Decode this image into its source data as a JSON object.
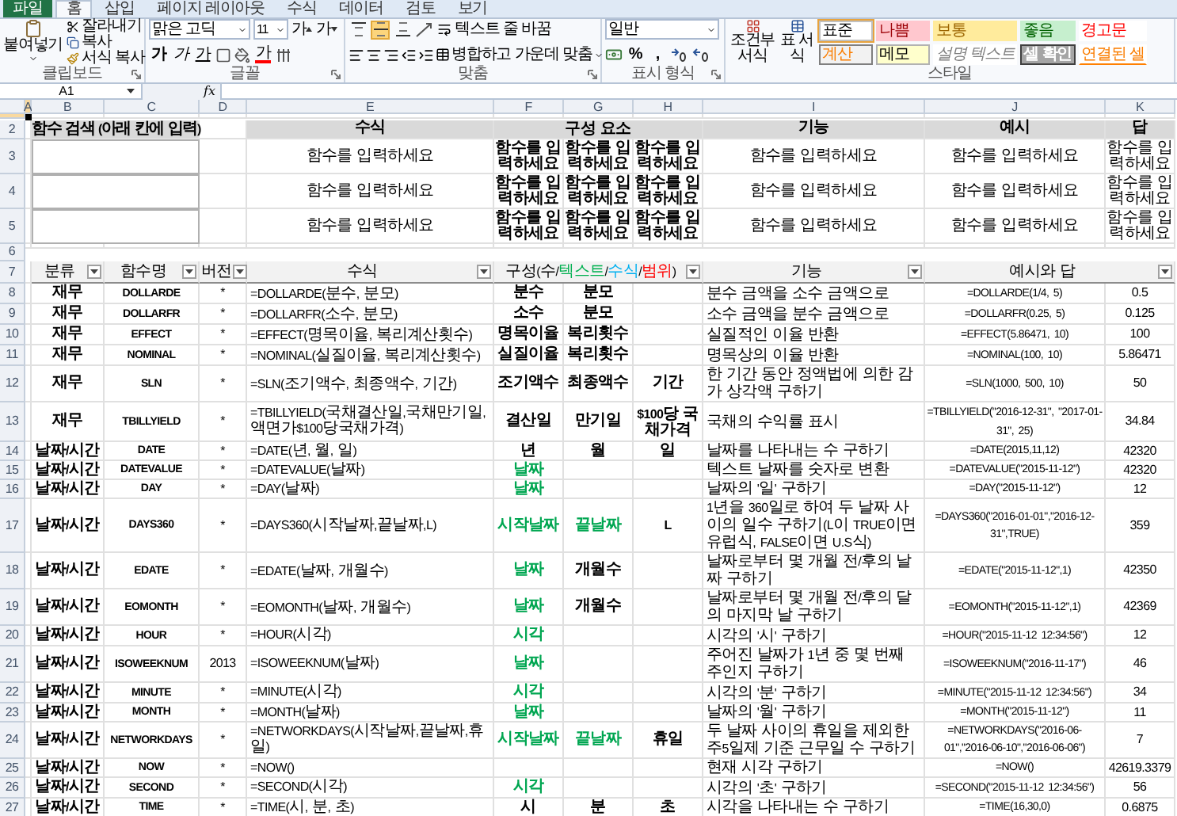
{
  "ribbon": {
    "tabs": [
      {
        "label": "파일",
        "kind": "file",
        "selected": false
      },
      {
        "label": "홈",
        "kind": "tab",
        "selected": true
      },
      {
        "label": "삽입",
        "kind": "tab",
        "selected": false
      },
      {
        "label": "페이지 레이아웃",
        "kind": "tab",
        "selected": false
      },
      {
        "label": "수식",
        "kind": "tab",
        "selected": false
      },
      {
        "label": "데이터",
        "kind": "tab",
        "selected": false
      },
      {
        "label": "검토",
        "kind": "tab",
        "selected": false
      },
      {
        "label": "보기",
        "kind": "tab",
        "selected": false
      }
    ],
    "clipboard": {
      "paste": "붙여넣기",
      "cut": "잘라내기",
      "copy": "복사",
      "format_painter": "서식 복사",
      "label": "클립보드"
    },
    "font": {
      "name": "맑은 고딕",
      "size": "11",
      "grow": "가",
      "shrink": "가",
      "bold": "가",
      "italic": "가",
      "underline": "가",
      "font_color": "가",
      "label": "글꼴"
    },
    "alignment": {
      "vertical": [
        {
          "kind": "top",
          "selected": false
        },
        {
          "kind": "middle",
          "selected": true
        },
        {
          "kind": "bottom",
          "selected": false
        }
      ],
      "wrap": "텍스트 줄 바꿈",
      "merge": "병합하고 가운데 맞춤",
      "label": "맞춤"
    },
    "number": {
      "format": "일반",
      "percent": "%",
      "comma": ",",
      "label": "표시 형식"
    },
    "styles": {
      "conditional": "조건부 서식",
      "table": "표 서식",
      "items": [
        {
          "label": "표준",
          "kind": "normal",
          "selected": true
        },
        {
          "label": "나쁨",
          "kind": "bad",
          "selected": false
        },
        {
          "label": "보통",
          "kind": "neutral",
          "selected": false
        },
        {
          "label": "좋음",
          "kind": "good",
          "selected": false
        },
        {
          "label": "경고문",
          "kind": "warning",
          "selected": false
        },
        {
          "label": "계산",
          "kind": "calculation",
          "selected": false
        },
        {
          "label": "메모",
          "kind": "note",
          "selected": false
        },
        {
          "label": "설명 텍스트",
          "kind": "explanatory",
          "selected": false
        },
        {
          "label": "셀 확인",
          "kind": "check",
          "selected": false
        },
        {
          "label": "연결된 셀",
          "kind": "linked",
          "selected": false
        }
      ],
      "label": "스타일"
    }
  },
  "formula_bar": {
    "name_box": "A1",
    "function_label": "fx"
  },
  "columns": [
    {
      "letter": "A",
      "selected": true
    },
    {
      "letter": "B",
      "selected": false
    },
    {
      "letter": "C",
      "selected": false
    },
    {
      "letter": "D",
      "selected": false
    },
    {
      "letter": "E",
      "selected": false
    },
    {
      "letter": "F",
      "selected": false
    },
    {
      "letter": "G",
      "selected": false
    },
    {
      "letter": "H",
      "selected": false
    },
    {
      "letter": "I",
      "selected": false
    },
    {
      "letter": "J",
      "selected": false
    },
    {
      "letter": "K",
      "selected": false
    }
  ],
  "first_row": {
    "selected": true
  },
  "header_row": {
    "number": "2",
    "search_title": "함수 검색 (아래 칸에 입력)",
    "formula": "수식",
    "components": "구성 요소",
    "function": "기능",
    "example": "예시",
    "answer": "답"
  },
  "preview_rows": [
    {
      "number": "3",
      "formula": "함수를 입력하세요",
      "components": [
        "함수를 입력하세요",
        "함수를 입력하세요",
        "함수를 입력하세요"
      ],
      "function": "함수를 입력하세요",
      "example": "함수를 입력하세요",
      "answer": "함수를 입력하세요"
    },
    {
      "number": "4",
      "formula": "함수를 입력하세요",
      "components": [
        "함수를 입력하세요",
        "함수를 입력하세요",
        "함수를 입력하세요"
      ],
      "function": "함수를 입력하세요",
      "example": "함수를 입력하세요",
      "answer": "함수를 입력하세요"
    },
    {
      "number": "5",
      "formula": "함수를 입력하세요",
      "components": [
        "함수를 입력하세요",
        "함수를 입력하세요",
        "함수를 입력하세요"
      ],
      "function": "함수를 입력하세요",
      "example": "함수를 입력하세요",
      "answer": "함수를 입력하세요"
    }
  ],
  "blank_row": {
    "number": "6"
  },
  "table_header": {
    "number": "7",
    "category": "분류",
    "name": "함수명",
    "version": "버전",
    "formula": "수식",
    "components": [
      {
        "text": "구성("
      },
      {
        "text": "수",
        "color": "#000000"
      },
      {
        "text": "/"
      },
      {
        "text": "텍스트",
        "color": "#00b050"
      },
      {
        "text": "/"
      },
      {
        "text": "수식",
        "color": "#00b0f0"
      },
      {
        "text": "/"
      },
      {
        "text": "범위",
        "color": "#ff0000"
      },
      {
        "text": ")"
      }
    ],
    "function": "기능",
    "example": "예시와 답"
  },
  "rows": [
    {
      "number": "8",
      "category": "재무",
      "name": "DOLLARDE",
      "version": "*",
      "formula": "=DOLLARDE(분수, 분모)",
      "parts": [
        {
          "text": "분수",
          "kind": "number"
        },
        {
          "text": "분모",
          "kind": "number"
        }
      ],
      "function": "분수 금액을 소수 금액으로",
      "example": "=DOLLARDE(1/4, 5)",
      "answer": "0.5"
    },
    {
      "number": "9",
      "category": "재무",
      "name": "DOLLARFR",
      "version": "*",
      "formula": "=DOLLARFR(소수, 분모)",
      "parts": [
        {
          "text": "소수",
          "kind": "number"
        },
        {
          "text": "분모",
          "kind": "number"
        }
      ],
      "function": "소수 금액을 분수 금액으로",
      "example": "=DOLLARFR(0.25, 5)",
      "answer": "0.125"
    },
    {
      "number": "10",
      "category": "재무",
      "name": "EFFECT",
      "version": "*",
      "formula": "=EFFECT(명목이율, 복리계산횟수)",
      "parts": [
        {
          "text": "명목이율",
          "kind": "number"
        },
        {
          "text": "복리횟수",
          "kind": "number"
        }
      ],
      "function": "실질적인 이율 반환",
      "example": "=EFFECT(5.86471, 10)",
      "answer": "100"
    },
    {
      "number": "11",
      "category": "재무",
      "name": "NOMINAL",
      "version": "*",
      "formula": "=NOMINAL(실질이율, 복리계산횟수)",
      "parts": [
        {
          "text": "실질이율",
          "kind": "number"
        },
        {
          "text": "복리횟수",
          "kind": "number"
        }
      ],
      "function": "명목상의 이율 반환",
      "example": "=NOMINAL(100, 10)",
      "answer": "5.86471"
    },
    {
      "number": "12",
      "category": "재무",
      "name": "SLN",
      "version": "*",
      "formula": "=SLN(조기액수, 최종액수, 기간)",
      "parts": [
        {
          "text": "조기액수",
          "kind": "number"
        },
        {
          "text": "최종액수",
          "kind": "number"
        },
        {
          "text": "기간",
          "kind": "number"
        }
      ],
      "function": "한 기간 동안 정액법에 의한 감가 상각액 구하기",
      "example": "=SLN(1000, 500, 10)",
      "answer": "50"
    },
    {
      "number": "13",
      "category": "재무",
      "name": "TBILLYIELD",
      "version": "*",
      "formula": "=TBILLYIELD(국채결산일,국채만기일,액면가$100당국채가격)",
      "parts": [
        {
          "text": "결산일",
          "kind": "number"
        },
        {
          "text": "만기일",
          "kind": "number"
        },
        {
          "text": "$100당 국채가격",
          "kind": "number"
        }
      ],
      "function": "국채의 수익률 표시",
      "example": "=TBILLYIELD(\"2016-12-31\", \"2017-01-31\", 25)",
      "answer": "34.84"
    },
    {
      "number": "14",
      "category": "날짜/시간",
      "name": "DATE",
      "version": "*",
      "formula": "=DATE(년, 월, 일)",
      "parts": [
        {
          "text": "년",
          "kind": "number"
        },
        {
          "text": "월",
          "kind": "number"
        },
        {
          "text": "일",
          "kind": "number"
        }
      ],
      "function": "날짜를 나타내는 수 구하기",
      "example": "=DATE(2015,11,12)",
      "answer": "42320"
    },
    {
      "number": "15",
      "category": "날짜/시간",
      "name": "DATEVALUE",
      "version": "*",
      "formula": "=DATEVALUE(날짜)",
      "parts": [
        {
          "text": "날짜",
          "kind": "text"
        }
      ],
      "function": "텍스트 날짜를 숫자로 변환",
      "example": "=DATEVALUE(\"2015-11-12\")",
      "answer": "42320"
    },
    {
      "number": "16",
      "category": "날짜/시간",
      "name": "DAY",
      "version": "*",
      "formula": "=DAY(날짜)",
      "parts": [
        {
          "text": "날짜",
          "kind": "text"
        }
      ],
      "function": "날짜의 '일' 구하기",
      "example": "=DAY(\"2015-11-12\")",
      "answer": "12"
    },
    {
      "number": "17",
      "category": "날짜/시간",
      "name": "DAYS360",
      "version": "*",
      "formula": "=DAYS360(시작날짜,끝날짜,L)",
      "parts": [
        {
          "text": "시작날짜",
          "kind": "text"
        },
        {
          "text": "끝날짜",
          "kind": "text"
        },
        {
          "text": "L",
          "kind": "number"
        }
      ],
      "function": "1년을 360일로 하여 두 날짜 사이의 일수 구하기(L이 TRUE이면 유럽식, FALSE이면 U.S식)",
      "example": "=DAYS360(\"2016-01-01\",\"2016-12-31\",TRUE)",
      "answer": "359"
    },
    {
      "number": "18",
      "category": "날짜/시간",
      "name": "EDATE",
      "version": "*",
      "formula": "=EDATE(날짜, 개월수)",
      "parts": [
        {
          "text": "날짜",
          "kind": "text"
        },
        {
          "text": "개월수",
          "kind": "number"
        }
      ],
      "function": "날짜로부터 몇 개월 전/후의 날짜 구하기",
      "example": "=EDATE(\"2015-11-12\",1)",
      "answer": "42350"
    },
    {
      "number": "19",
      "category": "날짜/시간",
      "name": "EOMONTH",
      "version": "*",
      "formula": "=EOMONTH(날짜, 개월수)",
      "parts": [
        {
          "text": "날짜",
          "kind": "text"
        },
        {
          "text": "개월수",
          "kind": "number"
        }
      ],
      "function": "날짜로부터 몇 개월 전/후의 달의 마지막 날 구하기",
      "example": "=EOMONTH(\"2015-11-12\",1)",
      "answer": "42369"
    },
    {
      "number": "20",
      "category": "날짜/시간",
      "name": "HOUR",
      "version": "*",
      "formula": "=HOUR(시각)",
      "parts": [
        {
          "text": "시각",
          "kind": "text"
        }
      ],
      "function": "시각의 '시' 구하기",
      "example": "=HOUR(\"2015-11-12 12:34:56\")",
      "answer": "12"
    },
    {
      "number": "21",
      "category": "날짜/시간",
      "name": "ISOWEEKNUM",
      "version": "2013",
      "formula": "=ISOWEEKNUM(날짜)",
      "parts": [
        {
          "text": "날짜",
          "kind": "text"
        }
      ],
      "function": "주어진 날짜가 1년 중 몇 번째 주인지 구하기",
      "example": "=ISOWEEKNUM(\"2016-11-17\")",
      "answer": "46"
    },
    {
      "number": "22",
      "category": "날짜/시간",
      "name": "MINUTE",
      "version": "*",
      "formula": "=MINUTE(시각)",
      "parts": [
        {
          "text": "시각",
          "kind": "text"
        }
      ],
      "function": "시각의 '분' 구하기",
      "example": "=MINUTE(\"2015-11-12 12:34:56\")",
      "answer": "34"
    },
    {
      "number": "23",
      "category": "날짜/시간",
      "name": "MONTH",
      "version": "*",
      "formula": "=MONTH(날짜)",
      "parts": [
        {
          "text": "날짜",
          "kind": "text"
        }
      ],
      "function": "날짜의 '월' 구하기",
      "example": "=MONTH(\"2015-11-12\")",
      "answer": "11"
    },
    {
      "number": "24",
      "category": "날짜/시간",
      "name": "NETWORKDAYS",
      "version": "*",
      "formula": "=NETWORKDAYS(시작날짜,끝날짜,휴일)",
      "parts": [
        {
          "text": "시작날짜",
          "kind": "text"
        },
        {
          "text": "끝날짜",
          "kind": "text"
        },
        {
          "text": "휴일",
          "kind": "number"
        }
      ],
      "function": "두 날짜 사이의 휴일을 제외한 주5일제 기준 근무일 수 구하기",
      "example": "=NETWORKDAYS(\"2016-06-01\",\"2016-06-10\",\"2016-06-06\")",
      "answer": "7"
    },
    {
      "number": "25",
      "category": "날짜/시간",
      "name": "NOW",
      "version": "*",
      "formula": "=NOW()",
      "parts": [],
      "function": "현재 시각 구하기",
      "example": "=NOW()",
      "answer": "42619.3379"
    },
    {
      "number": "26",
      "category": "날짜/시간",
      "name": "SECOND",
      "version": "*",
      "formula": "=SECOND(시각)",
      "parts": [
        {
          "text": "시각",
          "kind": "text"
        }
      ],
      "function": "시각의 '초' 구하기",
      "example": "=SECOND(\"2015-11-12 12:34:56\")",
      "answer": "56"
    },
    {
      "number": "27",
      "category": "날짜/시간",
      "name": "TIME",
      "version": "*",
      "formula": "=TIME(시, 분, 초)",
      "parts": [
        {
          "text": "시",
          "kind": "number"
        },
        {
          "text": "분",
          "kind": "number"
        },
        {
          "text": "초",
          "kind": "number"
        }
      ],
      "function": "시각을 나타내는 수 구하기",
      "example": "=TIME(16,30,0)",
      "answer": "0.6875"
    }
  ]
}
